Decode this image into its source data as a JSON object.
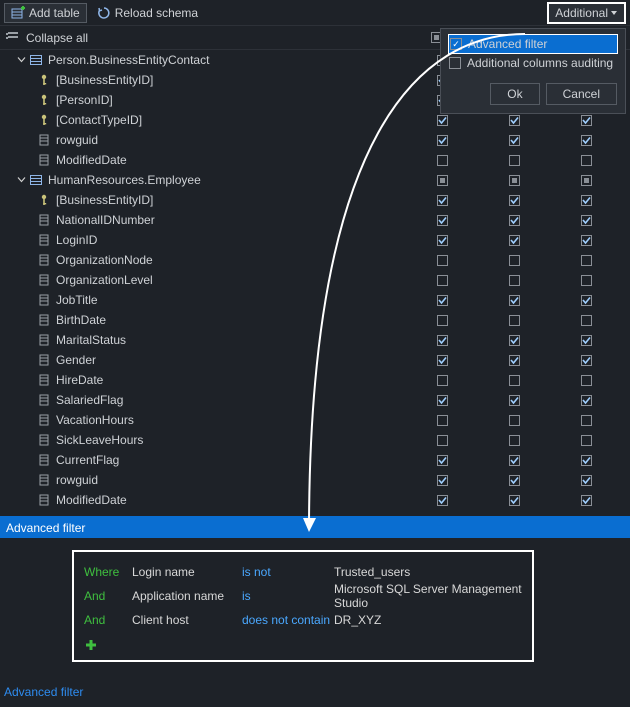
{
  "toolbar": {
    "add_table": "Add table",
    "reload_schema": "Reload schema",
    "additional": "Additional"
  },
  "collapse_all": "Collapse all",
  "popup": {
    "advanced_filter": "Advanced filter",
    "additional_auditing": "Additional columns auditing",
    "ok": "Ok",
    "cancel": "Cancel"
  },
  "tables": [
    {
      "name": "Person.BusinessEntityContact",
      "hdr": [
        "mixed",
        "mixed",
        "mixed"
      ],
      "cols": [
        {
          "icon": "key",
          "name": "[BusinessEntityID]",
          "c": [
            true,
            true,
            true
          ]
        },
        {
          "icon": "key",
          "name": "[PersonID]",
          "c": [
            true,
            true,
            true
          ]
        },
        {
          "icon": "key",
          "name": "[ContactTypeID]",
          "c": [
            true,
            true,
            true
          ]
        },
        {
          "icon": "col",
          "name": "rowguid",
          "c": [
            true,
            true,
            true
          ]
        },
        {
          "icon": "col",
          "name": "ModifiedDate",
          "c": [
            false,
            false,
            false
          ]
        }
      ]
    },
    {
      "name": "HumanResources.Employee",
      "hdr": [
        "mixed",
        "mixed",
        "mixed"
      ],
      "cols": [
        {
          "icon": "key",
          "name": "[BusinessEntityID]",
          "c": [
            true,
            true,
            true
          ]
        },
        {
          "icon": "col",
          "name": "NationalIDNumber",
          "c": [
            true,
            true,
            true
          ]
        },
        {
          "icon": "col",
          "name": "LoginID",
          "c": [
            true,
            true,
            true
          ]
        },
        {
          "icon": "col",
          "name": "OrganizationNode",
          "c": [
            false,
            false,
            false
          ]
        },
        {
          "icon": "col",
          "name": "OrganizationLevel",
          "c": [
            false,
            false,
            false
          ]
        },
        {
          "icon": "col",
          "name": "JobTitle",
          "c": [
            true,
            true,
            true
          ]
        },
        {
          "icon": "col",
          "name": "BirthDate",
          "c": [
            false,
            false,
            false
          ]
        },
        {
          "icon": "col",
          "name": "MaritalStatus",
          "c": [
            true,
            true,
            true
          ]
        },
        {
          "icon": "col",
          "name": "Gender",
          "c": [
            true,
            true,
            true
          ]
        },
        {
          "icon": "col",
          "name": "HireDate",
          "c": [
            false,
            false,
            false
          ]
        },
        {
          "icon": "col",
          "name": "SalariedFlag",
          "c": [
            true,
            true,
            true
          ]
        },
        {
          "icon": "col",
          "name": "VacationHours",
          "c": [
            false,
            false,
            false
          ]
        },
        {
          "icon": "col",
          "name": "SickLeaveHours",
          "c": [
            false,
            false,
            false
          ]
        },
        {
          "icon": "col",
          "name": "CurrentFlag",
          "c": [
            true,
            true,
            true
          ]
        },
        {
          "icon": "col",
          "name": "rowguid",
          "c": [
            true,
            true,
            true
          ]
        },
        {
          "icon": "col",
          "name": "ModifiedDate",
          "c": [
            true,
            true,
            true
          ]
        }
      ]
    }
  ],
  "filter": {
    "header": "Advanced filter",
    "rows": [
      {
        "conj": "Where",
        "field": "Login name",
        "op": "is not",
        "val": "Trusted_users"
      },
      {
        "conj": "And",
        "field": "Application name",
        "op": "is",
        "val": "Microsoft SQL Server Management Studio"
      },
      {
        "conj": "And",
        "field": "Client host",
        "op": "does not contain",
        "val": "DR_XYZ"
      }
    ]
  },
  "footer_link": "Advanced filter"
}
